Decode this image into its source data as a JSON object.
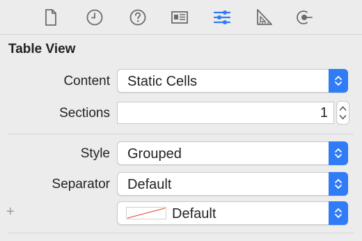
{
  "toolbar": {
    "tabs": [
      {
        "icon": "file-icon"
      },
      {
        "icon": "history-icon"
      },
      {
        "icon": "help-icon"
      },
      {
        "icon": "identity-icon"
      },
      {
        "icon": "attributes-icon",
        "selected": true
      },
      {
        "icon": "size-icon"
      },
      {
        "icon": "connections-icon"
      }
    ],
    "selected_color": "#2f7cf6",
    "icon_color": "#6b6b6b"
  },
  "section": {
    "title": "Table View"
  },
  "content": {
    "label": "Content",
    "value": "Static Cells"
  },
  "sections": {
    "label": "Sections",
    "value": "1"
  },
  "style": {
    "label": "Style",
    "value": "Grouped"
  },
  "separator": {
    "label": "Separator",
    "value": "Default"
  },
  "separator_color": {
    "add_label": "+",
    "value": "Default",
    "swatch_line_color": "#e0442e"
  },
  "accent": "#2f7cf6"
}
